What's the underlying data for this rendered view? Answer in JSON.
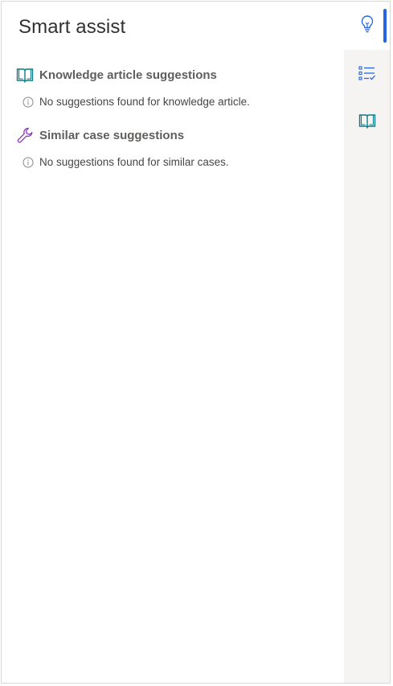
{
  "panel": {
    "title": "Smart assist"
  },
  "sections": [
    {
      "icon": "book-open-icon",
      "label": "Knowledge article suggestions",
      "empty_message": "No suggestions found for knowledge article."
    },
    {
      "icon": "wrench-icon",
      "label": "Similar case suggestions",
      "empty_message": "No suggestions found for similar cases."
    }
  ],
  "rail": {
    "items": [
      {
        "icon": "lightbulb-icon",
        "active": true
      },
      {
        "icon": "checklist-icon",
        "active": false
      },
      {
        "icon": "book-icon",
        "active": false
      }
    ]
  },
  "colors": {
    "accent": "#2266e3",
    "knowledge_icon": "#0e7c86",
    "wrench_icon": "#8a3ab9",
    "rail_background": "#f5f4f3"
  }
}
